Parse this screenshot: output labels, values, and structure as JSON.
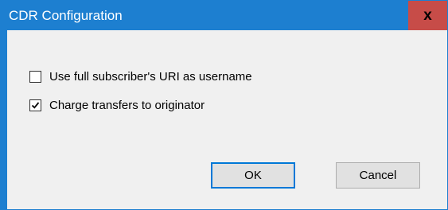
{
  "dialog": {
    "title": "CDR Configuration",
    "close_label": "x"
  },
  "options": [
    {
      "label": "Use full subscriber's URI as username",
      "checked": false
    },
    {
      "label": "Charge transfers to originator",
      "checked": true
    }
  ],
  "buttons": {
    "ok_label": "OK",
    "cancel_label": "Cancel"
  },
  "colors": {
    "titlebar": "#1d7fd0",
    "close_button": "#c74c48",
    "client_background": "#f0f0f0",
    "default_button_border": "#0078d7"
  }
}
